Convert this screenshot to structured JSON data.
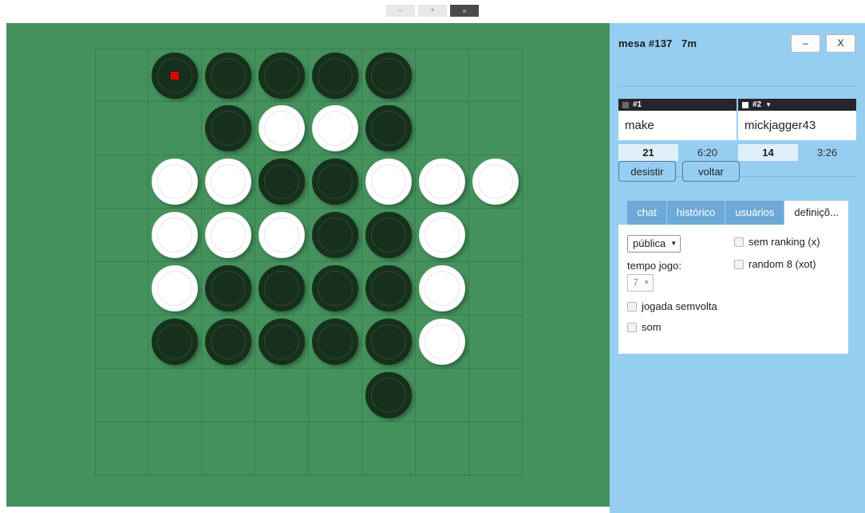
{
  "toolbar": {
    "zoom_out_label": "–",
    "zoom_in_label": "+",
    "fullscreen_label": ""
  },
  "panel": {
    "title": "mesa #137   7m",
    "minimize_label": "–",
    "close_label": "X"
  },
  "players": [
    {
      "tag": "#1",
      "chip": "dark",
      "name": "make",
      "score": "21",
      "clock": "6:20",
      "active": false
    },
    {
      "tag": "#2",
      "chip": "light",
      "name": "mickjagger43",
      "score": "14",
      "clock": "3:26",
      "active": true,
      "turn_marker": "▼"
    }
  ],
  "actions": {
    "resign_label": "desistir",
    "back_label": "voltar"
  },
  "tabs": [
    {
      "label": "chat",
      "active": false
    },
    {
      "label": "histórico",
      "active": false
    },
    {
      "label": "usuários",
      "active": false
    },
    {
      "label": "definiçõ...",
      "active": true
    }
  ],
  "settings": {
    "visibility": {
      "value": "pública",
      "caret": "▼"
    },
    "time_label": "tempo jogo:",
    "time": {
      "value": "7",
      "caret": "▼",
      "disabled": true
    },
    "checkboxes_left": [
      {
        "label": "jogada semvolta",
        "checked": false
      },
      {
        "label": "som",
        "checked": false
      }
    ],
    "checkboxes_right": [
      {
        "label": "sem ranking (x)",
        "checked": false
      },
      {
        "label": "random 8 (xot)",
        "checked": false
      }
    ]
  },
  "colors": {
    "board_green": "#44915c",
    "grid_line": "#3b7c50",
    "panel_blue": "#96cef2",
    "tab_blue": "#6ca9d6",
    "piece_black": "#16301c",
    "piece_white": "#ffffff",
    "marker_red": "#e50000",
    "score_bg": "#dff0fb",
    "player_bar": "#24262b"
  },
  "board": {
    "size": 8,
    "last_move": {
      "row": 0,
      "col": 1
    },
    "cells": [
      [
        "",
        "black",
        "black",
        "black",
        "black",
        "black",
        "",
        ""
      ],
      [
        "",
        "",
        "black",
        "white",
        "white",
        "black",
        "",
        ""
      ],
      [
        "",
        "white",
        "white",
        "black",
        "black",
        "white",
        "white",
        "white"
      ],
      [
        "",
        "white",
        "white",
        "white",
        "black",
        "black",
        "white",
        ""
      ],
      [
        "",
        "white",
        "black",
        "black",
        "black",
        "black",
        "white",
        ""
      ],
      [
        "",
        "black",
        "black",
        "black",
        "black",
        "black",
        "white",
        ""
      ],
      [
        "",
        "",
        "",
        "",
        "",
        "black",
        "",
        ""
      ],
      [
        "",
        "",
        "",
        "",
        "",
        "",
        "",
        ""
      ]
    ]
  }
}
